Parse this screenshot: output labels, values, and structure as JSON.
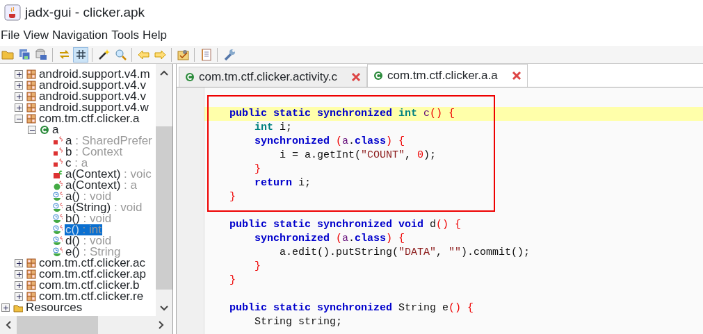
{
  "window": {
    "title": "jadx-gui - clicker.apk"
  },
  "menu": [
    "File",
    "View",
    "Navigation",
    "Tools",
    "Help"
  ],
  "toolbar": [
    {
      "kind": "button",
      "pressed": false
    },
    {
      "kind": "button",
      "pressed": false
    },
    {
      "kind": "button",
      "pressed": false
    },
    {
      "kind": "separator"
    },
    {
      "kind": "button",
      "pressed": false
    },
    {
      "kind": "button",
      "pressed": true
    },
    {
      "kind": "separator"
    },
    {
      "kind": "button",
      "pressed": false
    },
    {
      "kind": "button",
      "pressed": false
    },
    {
      "kind": "separator"
    },
    {
      "kind": "button",
      "pressed": false
    },
    {
      "kind": "button",
      "pressed": false
    },
    {
      "kind": "separator"
    },
    {
      "kind": "button",
      "pressed": false
    },
    {
      "kind": "separator"
    },
    {
      "kind": "button",
      "pressed": false
    },
    {
      "kind": "separator"
    },
    {
      "kind": "button",
      "pressed": false
    }
  ],
  "tree": {
    "items": [
      {
        "kind": "root",
        "children": [
          {
            "kind": "package",
            "label": "android.support.v4.m",
            "expanded": false,
            "selected": false
          },
          {
            "kind": "package",
            "label": "android.support.v4.v",
            "expanded": false,
            "selected": false
          },
          {
            "kind": "package",
            "label": "android.support.v4.v",
            "expanded": false,
            "selected": false
          },
          {
            "kind": "package",
            "label": "android.support.v4.w",
            "expanded": false,
            "selected": false
          },
          {
            "kind": "package",
            "label": "com.tm.ctf.clicker.a",
            "expanded": true,
            "selected": false,
            "children": [
              {
                "kind": "class",
                "label": "a",
                "expanded": true,
                "selected": false,
                "children": [
                  {
                    "kind": "field",
                    "label": "a",
                    "type": ": SharedPrefer",
                    "selected": false
                  },
                  {
                    "kind": "field",
                    "label": "b",
                    "type": ": Context",
                    "selected": false
                  },
                  {
                    "kind": "field",
                    "label": "c",
                    "type": ": a",
                    "selected": false
                  },
                  {
                    "kind": "constructor",
                    "label": "a(Context)",
                    "type": ": voic",
                    "selected": false
                  },
                  {
                    "kind": "static-method",
                    "label": "a(Context)",
                    "type": ": a",
                    "selected": false
                  },
                  {
                    "kind": "sync-method",
                    "label": "a()",
                    "type": ": void",
                    "selected": false
                  },
                  {
                    "kind": "sync-method",
                    "label": "a(String)",
                    "type": ": void",
                    "selected": false
                  },
                  {
                    "kind": "sync-method",
                    "label": "b()",
                    "type": ": void",
                    "selected": false
                  },
                  {
                    "kind": "sync-method",
                    "label": "c()",
                    "type": ": int",
                    "selected": true
                  },
                  {
                    "kind": "sync-method",
                    "label": "d()",
                    "type": ": void",
                    "selected": false
                  },
                  {
                    "kind": "sync-method",
                    "label": "e()",
                    "type": ": String",
                    "selected": false
                  }
                ]
              }
            ]
          },
          {
            "kind": "package",
            "label": "com.tm.ctf.clicker.ac",
            "expanded": false,
            "selected": false
          },
          {
            "kind": "package",
            "label": "com.tm.ctf.clicker.ap",
            "expanded": false,
            "selected": false
          },
          {
            "kind": "package",
            "label": "com.tm.ctf.clicker.b",
            "expanded": false,
            "selected": false
          },
          {
            "kind": "package",
            "label": "com.tm.ctf.clicker.re",
            "expanded": false,
            "selected": false
          }
        ]
      },
      {
        "kind": "resources",
        "label": "Resources",
        "expanded": false,
        "selected": false
      }
    ]
  },
  "tabs": [
    {
      "label": "com.tm.ctf.clicker.activity.c",
      "selected": false
    },
    {
      "label": "com.tm.ctf.clicker.a.a",
      "selected": true
    }
  ],
  "code": {
    "lines": [
      {
        "highlighted": true,
        "annotated": true,
        "tokens": [
          {
            "kind": "kw",
            "text": "    public static synchronized "
          },
          {
            "kind": "type",
            "text": "int "
          },
          {
            "kind": "name",
            "text": "c"
          },
          {
            "kind": "punc",
            "text": "() {"
          }
        ]
      },
      {
        "highlighted": false,
        "annotated": true,
        "tokens": [
          {
            "kind": "type",
            "text": "        int "
          },
          {
            "kind": "plain",
            "text": "i;"
          }
        ]
      },
      {
        "highlighted": false,
        "annotated": true,
        "tokens": [
          {
            "kind": "kw",
            "text": "        synchronized "
          },
          {
            "kind": "punc",
            "text": "("
          },
          {
            "kind": "name",
            "text": "a"
          },
          {
            "kind": "plain",
            "text": "."
          },
          {
            "kind": "kw",
            "text": "class"
          },
          {
            "kind": "punc",
            "text": ") {"
          }
        ]
      },
      {
        "highlighted": false,
        "annotated": true,
        "tokens": [
          {
            "kind": "plain",
            "text": "            i = a.getInt("
          },
          {
            "kind": "str",
            "text": "\"COUNT\""
          },
          {
            "kind": "plain",
            "text": ", "
          },
          {
            "kind": "num",
            "text": "0"
          },
          {
            "kind": "plain",
            "text": ");"
          }
        ]
      },
      {
        "highlighted": false,
        "annotated": true,
        "tokens": [
          {
            "kind": "punc",
            "text": "        }"
          }
        ]
      },
      {
        "highlighted": false,
        "annotated": true,
        "tokens": [
          {
            "kind": "kw",
            "text": "        return "
          },
          {
            "kind": "plain",
            "text": "i;"
          }
        ]
      },
      {
        "highlighted": false,
        "annotated": true,
        "tokens": [
          {
            "kind": "punc",
            "text": "    }"
          }
        ]
      },
      {
        "highlighted": false,
        "annotated": false
      },
      {
        "highlighted": false,
        "annotated": false,
        "tokens": [
          {
            "kind": "kw",
            "text": "    public static synchronized void "
          },
          {
            "kind": "plain",
            "text": "d"
          },
          {
            "kind": "punc",
            "text": "() {"
          }
        ]
      },
      {
        "highlighted": false,
        "annotated": false,
        "tokens": [
          {
            "kind": "kw",
            "text": "        synchronized "
          },
          {
            "kind": "punc",
            "text": "("
          },
          {
            "kind": "name",
            "text": "a"
          },
          {
            "kind": "plain",
            "text": "."
          },
          {
            "kind": "kw",
            "text": "class"
          },
          {
            "kind": "punc",
            "text": ") {"
          }
        ]
      },
      {
        "highlighted": false,
        "annotated": false,
        "tokens": [
          {
            "kind": "plain",
            "text": "            a.edit().putString("
          },
          {
            "kind": "str",
            "text": "\"DATA\""
          },
          {
            "kind": "plain",
            "text": ", "
          },
          {
            "kind": "str",
            "text": "\"\""
          },
          {
            "kind": "plain",
            "text": ").commit();"
          }
        ]
      },
      {
        "highlighted": false,
        "annotated": false,
        "tokens": [
          {
            "kind": "punc",
            "text": "        }"
          }
        ]
      },
      {
        "highlighted": false,
        "annotated": false,
        "tokens": [
          {
            "kind": "punc",
            "text": "    }"
          }
        ]
      },
      {
        "highlighted": false,
        "annotated": false
      },
      {
        "highlighted": false,
        "annotated": false,
        "tokens": [
          {
            "kind": "kw",
            "text": "    public static synchronized "
          },
          {
            "kind": "plain",
            "text": "String e"
          },
          {
            "kind": "punc",
            "text": "() {"
          }
        ]
      },
      {
        "highlighted": false,
        "annotated": false,
        "tokens": [
          {
            "kind": "plain",
            "text": "        String string;"
          }
        ]
      }
    ]
  }
}
